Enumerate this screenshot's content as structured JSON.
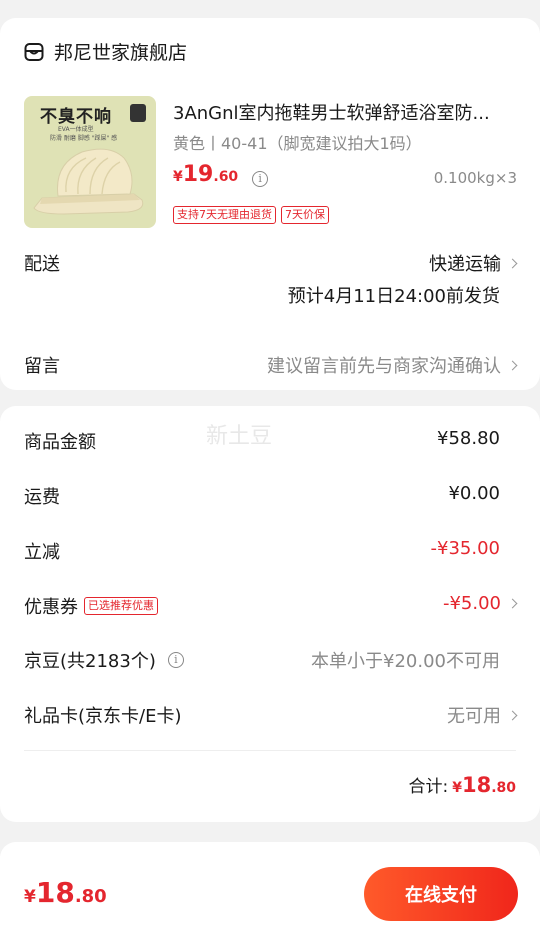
{
  "shop": {
    "name": "邦尼世家旗舰店",
    "product": {
      "image_title": "不臭不响",
      "image_sub1": "EVA一体成型",
      "image_sub2": "防滑 耐磨 脚感 \"踩屎\" 感",
      "title": "3AnGnl室内拖鞋男士软弹舒适浴室防...",
      "variant": "黄色丨40-41（脚宽建议拍大1码）",
      "price_symbol": "¥",
      "price_int": "19",
      "price_dec": ".60",
      "qty": "0.100kg×3",
      "tags": [
        "支持7天无理由退货",
        "7天价保"
      ]
    },
    "delivery": {
      "label": "配送",
      "method": "快递运输",
      "eta": "预计4月11日24:00前发货"
    },
    "message": {
      "label": "留言",
      "hint": "建议留言前先与商家沟通确认"
    }
  },
  "watermark": "新土豆",
  "pricing": {
    "goods_label": "商品金额",
    "goods_value": "¥58.80",
    "shipping_label": "运费",
    "shipping_value": "¥0.00",
    "discount_label": "立减",
    "discount_value": "-¥35.00",
    "coupon_label": "优惠券",
    "coupon_tag": "已选推荐优惠",
    "coupon_value": "-¥5.00",
    "jingdou_label": "京豆(共2183个)",
    "jingdou_value": "本单小于¥20.00不可用",
    "giftcard_label": "礼品卡(京东卡/E卡)",
    "giftcard_value": "无可用",
    "total_label": "合计:",
    "total_symbol": "¥",
    "total_int": "18",
    "total_dec": ".80"
  },
  "bottom": {
    "price_symbol": "¥",
    "price_int": "18",
    "price_dec": ".80",
    "pay_label": "在线支付"
  },
  "colors": {
    "accent_red": "#e4262e",
    "button_gradient_start": "#ff5a2a",
    "button_gradient_end": "#f0261b"
  }
}
